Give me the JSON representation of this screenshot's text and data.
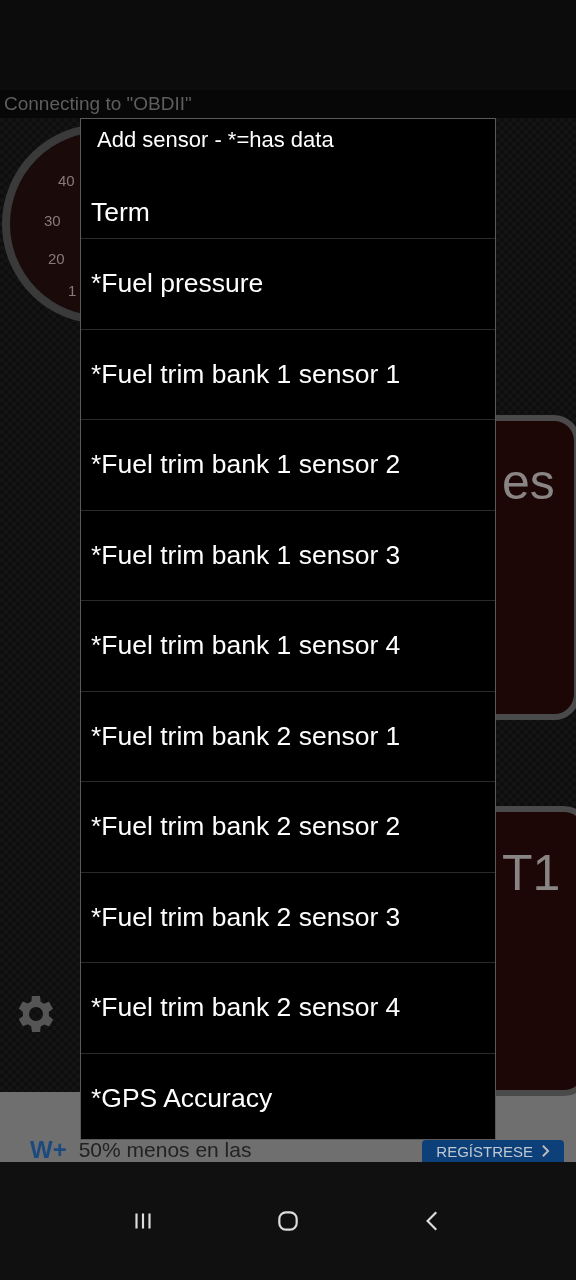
{
  "app": {
    "connection_status": "Connecting to \"OBDII\""
  },
  "gauges": [
    {
      "kind": "dial",
      "labels": [
        "40",
        "30",
        "20",
        "1"
      ]
    },
    {
      "kind": "panel",
      "labels": [
        "es"
      ]
    },
    {
      "kind": "panel",
      "labels": [
        "T1"
      ]
    }
  ],
  "dialog": {
    "title": "Add sensor - *=has data",
    "items": [
      {
        "kind": "partial",
        "label": "Term"
      },
      {
        "kind": "full",
        "label": "*Fuel pressure"
      },
      {
        "kind": "full",
        "label": "*Fuel trim bank 1 sensor 1"
      },
      {
        "kind": "full",
        "label": "*Fuel trim bank 1 sensor 2"
      },
      {
        "kind": "full",
        "label": "*Fuel trim bank 1 sensor 3"
      },
      {
        "kind": "full",
        "label": "*Fuel trim bank 1 sensor 4"
      },
      {
        "kind": "full",
        "label": "*Fuel trim bank 2 sensor 1"
      },
      {
        "kind": "full",
        "label": "*Fuel trim bank 2 sensor 2"
      },
      {
        "kind": "full",
        "label": "*Fuel trim bank 2 sensor 3"
      },
      {
        "kind": "full",
        "label": "*Fuel trim bank 2 sensor 4"
      },
      {
        "kind": "full",
        "label": "*GPS Accuracy"
      }
    ]
  },
  "ad": {
    "logo": "W+",
    "text": "50% menos en las",
    "button": "REGÍSTRESE"
  }
}
